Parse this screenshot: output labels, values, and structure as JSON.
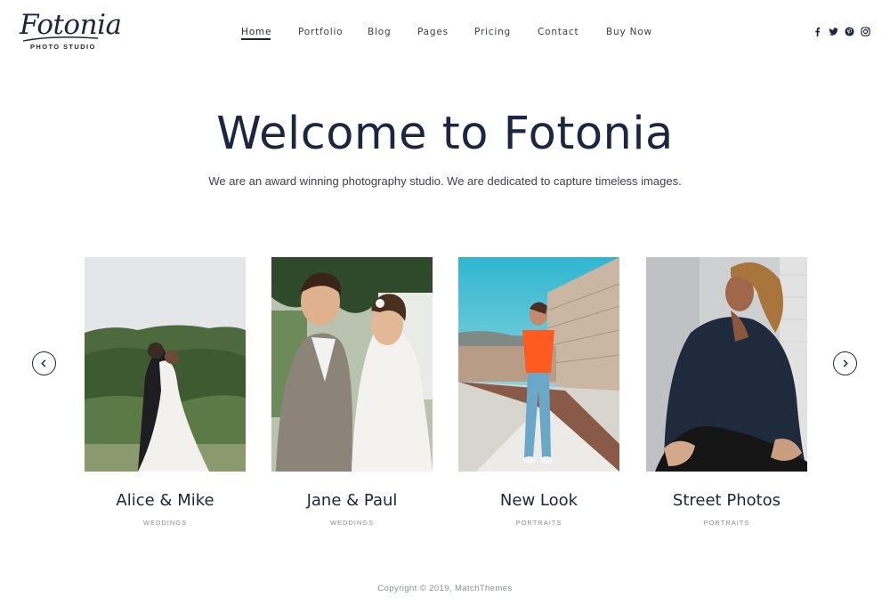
{
  "brand": {
    "name": "Fotonia",
    "tagline": "PHOTO STUDIO"
  },
  "nav": [
    {
      "label": "Home",
      "active": true
    },
    {
      "label": "Portfolio",
      "active": false
    },
    {
      "label": "Blog",
      "active": false
    },
    {
      "label": "Pages",
      "active": false
    },
    {
      "label": "Pricing",
      "active": false
    },
    {
      "label": "Contact",
      "active": false
    },
    {
      "label": "Buy Now",
      "active": false
    }
  ],
  "social": [
    "facebook-icon",
    "twitter-icon",
    "pinterest-icon",
    "instagram-icon"
  ],
  "hero": {
    "title": "Welcome to Fotonia",
    "subtitle": "We are an award winning photography studio. We are dedicated to capture timeless images."
  },
  "carousel": {
    "prev_icon": "chevron-left-icon",
    "next_icon": "chevron-right-icon",
    "items": [
      {
        "title": "Alice & Mike",
        "category": "WEDDINGS"
      },
      {
        "title": "Jane & Paul",
        "category": "WEDDINGS"
      },
      {
        "title": "New Look",
        "category": "PORTRAITS"
      },
      {
        "title": "Street Photos",
        "category": "PORTRAITS"
      }
    ]
  },
  "footer": {
    "copyright": "Copyright © 2019, MatchThemes"
  },
  "colors": {
    "primary": "#1c2541",
    "muted": "#8a8e99",
    "background": "#ffffff"
  }
}
